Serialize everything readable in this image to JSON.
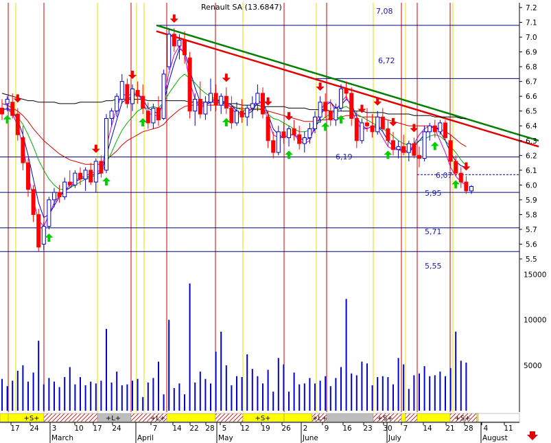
{
  "chart_data": {
    "type": "candlestick",
    "title": "Renault SA (13.6847)",
    "colors": {
      "background": "#ffffff",
      "up_candle": "#0000cc",
      "down_candle": "#ff0000",
      "sma_long": "#000000",
      "sma_mid": "#cc0000",
      "sma_short": "#00aa00",
      "sma_fast": "#0000cc",
      "sma_fastest": "#cc00cc",
      "volume": "#0000cc",
      "buy_arrow": "#00cc00",
      "sell_arrow": "#ee0000",
      "trend_green": "#008000",
      "trend_red": "#e00000",
      "level_line": "#000080",
      "cycle_red": "#cc0000",
      "cycle_yellow": "#e6e000",
      "band_yellow": "#ffff00",
      "band_hatch": "#cc0000",
      "band_gray": "#bdbdbd"
    },
    "ylim": [
      5.5,
      7.2
    ],
    "yticks": [
      "7.2",
      "7.1",
      "7.0",
      "6.9",
      "6.8",
      "6.7",
      "6.6",
      "6.5",
      "6.4",
      "6.3",
      "6.2",
      "6.1",
      "6.0",
      "5.9",
      "5.8",
      "5.7",
      "5.6",
      "5.5"
    ],
    "volume_ylim": [
      0,
      17000
    ],
    "volume_ticks": [
      "15000",
      "10000",
      "5000"
    ],
    "x_day_ticks": [
      "17",
      "24",
      "3",
      "10",
      "17",
      "24",
      "7",
      "14",
      "22",
      "28",
      "5",
      "12",
      "19",
      "26",
      "2",
      "9",
      "16",
      "23",
      "30",
      "7",
      "14",
      "21",
      "28",
      "4",
      "11"
    ],
    "x_month_labels": [
      "March",
      "April",
      "May",
      "June",
      "July",
      "August"
    ],
    "level_labels": [
      "7,08",
      "6,72",
      "6,19",
      "6,07",
      "5,95",
      "5,71",
      "5,55"
    ],
    "levels": [
      7.08,
      6.72,
      6.19,
      6.07,
      5.95,
      5.71,
      5.55
    ],
    "trendlines": [
      {
        "color": "green",
        "from": [
          0,
          7.08
        ],
        "to": [
          1,
          6.3
        ]
      },
      {
        "color": "red",
        "from": [
          0,
          7.04
        ],
        "to": [
          1,
          6.26
        ]
      }
    ],
    "band_labels": [
      "+S+",
      "+L+",
      "+L+",
      "+S+",
      "+L+",
      "+S+",
      "+S+"
    ],
    "band_segments": [
      "yellow",
      "yellow",
      "hatch",
      "gray",
      "hatch",
      "yellow",
      "hatch",
      "yellow",
      "yellow",
      "hatch",
      "gray",
      "hatch",
      "yellow",
      "hatch",
      "yellow",
      "hatch",
      "yellow",
      "hatch"
    ],
    "candles": [
      {
        "o": 6.52,
        "h": 6.58,
        "l": 6.44,
        "c": 6.48
      },
      {
        "o": 6.55,
        "h": 6.6,
        "l": 6.5,
        "c": 6.58
      },
      {
        "o": 6.56,
        "h": 6.62,
        "l": 6.45,
        "c": 6.47
      },
      {
        "o": 6.48,
        "h": 6.52,
        "l": 6.3,
        "c": 6.34
      },
      {
        "o": 6.32,
        "h": 6.4,
        "l": 6.1,
        "c": 6.15
      },
      {
        "o": 6.15,
        "h": 6.18,
        "l": 5.92,
        "c": 5.97
      },
      {
        "o": 5.97,
        "h": 6.0,
        "l": 5.75,
        "c": 5.8
      },
      {
        "o": 5.8,
        "h": 5.84,
        "l": 5.55,
        "c": 5.58
      },
      {
        "o": 5.6,
        "h": 5.75,
        "l": 5.56,
        "c": 5.72
      },
      {
        "o": 5.72,
        "h": 5.92,
        "l": 5.7,
        "c": 5.9
      },
      {
        "o": 5.9,
        "h": 5.98,
        "l": 5.85,
        "c": 5.95
      },
      {
        "o": 5.95,
        "h": 6.0,
        "l": 5.88,
        "c": 5.92
      },
      {
        "o": 5.92,
        "h": 6.05,
        "l": 5.9,
        "c": 6.02
      },
      {
        "o": 6.02,
        "h": 6.1,
        "l": 5.98,
        "c": 6.0
      },
      {
        "o": 6.0,
        "h": 6.1,
        "l": 5.98,
        "c": 6.08
      },
      {
        "o": 6.08,
        "h": 6.12,
        "l": 6.0,
        "c": 6.04
      },
      {
        "o": 6.04,
        "h": 6.12,
        "l": 5.96,
        "c": 6.1
      },
      {
        "o": 6.1,
        "h": 6.15,
        "l": 6.0,
        "c": 6.02
      },
      {
        "o": 6.02,
        "h": 6.18,
        "l": 5.95,
        "c": 6.16
      },
      {
        "o": 6.16,
        "h": 6.2,
        "l": 6.05,
        "c": 6.08
      },
      {
        "o": 6.1,
        "h": 6.48,
        "l": 6.08,
        "c": 6.45
      },
      {
        "o": 6.45,
        "h": 6.52,
        "l": 6.4,
        "c": 6.5
      },
      {
        "o": 6.5,
        "h": 6.62,
        "l": 6.46,
        "c": 6.6
      },
      {
        "o": 6.58,
        "h": 6.75,
        "l": 6.55,
        "c": 6.7
      },
      {
        "o": 6.68,
        "h": 6.72,
        "l": 6.52,
        "c": 6.55
      },
      {
        "o": 6.55,
        "h": 6.68,
        "l": 6.5,
        "c": 6.65
      },
      {
        "o": 6.64,
        "h": 6.7,
        "l": 6.55,
        "c": 6.6
      },
      {
        "o": 6.6,
        "h": 6.68,
        "l": 6.48,
        "c": 6.52
      },
      {
        "o": 6.5,
        "h": 6.56,
        "l": 6.38,
        "c": 6.42
      },
      {
        "o": 6.42,
        "h": 6.55,
        "l": 6.38,
        "c": 6.52
      },
      {
        "o": 6.52,
        "h": 6.6,
        "l": 6.4,
        "c": 6.44
      },
      {
        "o": 6.45,
        "h": 6.78,
        "l": 6.44,
        "c": 6.75
      },
      {
        "o": 6.8,
        "h": 7.05,
        "l": 6.78,
        "c": 7.02
      },
      {
        "o": 7.02,
        "h": 7.06,
        "l": 6.9,
        "c": 6.94
      },
      {
        "o": 6.94,
        "h": 7.02,
        "l": 6.85,
        "c": 6.98
      },
      {
        "o": 6.98,
        "h": 7.04,
        "l": 6.82,
        "c": 6.88
      },
      {
        "o": 6.86,
        "h": 6.9,
        "l": 6.45,
        "c": 6.5
      },
      {
        "o": 6.5,
        "h": 6.62,
        "l": 6.4,
        "c": 6.58
      },
      {
        "o": 6.58,
        "h": 6.7,
        "l": 6.45,
        "c": 6.48
      },
      {
        "o": 6.48,
        "h": 6.6,
        "l": 6.44,
        "c": 6.56
      },
      {
        "o": 6.56,
        "h": 6.72,
        "l": 6.5,
        "c": 6.62
      },
      {
        "o": 6.62,
        "h": 6.68,
        "l": 6.5,
        "c": 6.54
      },
      {
        "o": 6.54,
        "h": 6.62,
        "l": 6.48,
        "c": 6.6
      },
      {
        "o": 6.6,
        "h": 6.66,
        "l": 6.48,
        "c": 6.52
      },
      {
        "o": 6.52,
        "h": 6.6,
        "l": 6.38,
        "c": 6.42
      },
      {
        "o": 6.42,
        "h": 6.56,
        "l": 6.4,
        "c": 6.5
      },
      {
        "o": 6.5,
        "h": 6.58,
        "l": 6.42,
        "c": 6.46
      },
      {
        "o": 6.46,
        "h": 6.54,
        "l": 6.4,
        "c": 6.52
      },
      {
        "o": 6.52,
        "h": 6.6,
        "l": 6.45,
        "c": 6.55
      },
      {
        "o": 6.55,
        "h": 6.68,
        "l": 6.5,
        "c": 6.62
      },
      {
        "o": 6.62,
        "h": 6.66,
        "l": 6.45,
        "c": 6.48
      },
      {
        "o": 6.46,
        "h": 6.5,
        "l": 6.25,
        "c": 6.3
      },
      {
        "o": 6.3,
        "h": 6.36,
        "l": 6.18,
        "c": 6.22
      },
      {
        "o": 6.22,
        "h": 6.4,
        "l": 6.2,
        "c": 6.36
      },
      {
        "o": 6.36,
        "h": 6.42,
        "l": 6.28,
        "c": 6.32
      },
      {
        "o": 6.32,
        "h": 6.4,
        "l": 6.26,
        "c": 6.38
      },
      {
        "o": 6.38,
        "h": 6.44,
        "l": 6.3,
        "c": 6.34
      },
      {
        "o": 6.34,
        "h": 6.4,
        "l": 6.24,
        "c": 6.28
      },
      {
        "o": 6.28,
        "h": 6.36,
        "l": 6.22,
        "c": 6.32
      },
      {
        "o": 6.32,
        "h": 6.42,
        "l": 6.28,
        "c": 6.38
      },
      {
        "o": 6.38,
        "h": 6.5,
        "l": 6.35,
        "c": 6.46
      },
      {
        "o": 6.46,
        "h": 6.6,
        "l": 6.42,
        "c": 6.56
      },
      {
        "o": 6.56,
        "h": 6.62,
        "l": 6.45,
        "c": 6.5
      },
      {
        "o": 6.5,
        "h": 6.58,
        "l": 6.4,
        "c": 6.44
      },
      {
        "o": 6.44,
        "h": 6.55,
        "l": 6.4,
        "c": 6.52
      },
      {
        "o": 6.52,
        "h": 6.68,
        "l": 6.5,
        "c": 6.65
      },
      {
        "o": 6.65,
        "h": 6.7,
        "l": 6.58,
        "c": 6.62
      },
      {
        "o": 6.62,
        "h": 6.66,
        "l": 6.4,
        "c": 6.45
      },
      {
        "o": 6.45,
        "h": 6.5,
        "l": 6.25,
        "c": 6.3
      },
      {
        "o": 6.3,
        "h": 6.45,
        "l": 6.28,
        "c": 6.42
      },
      {
        "o": 6.42,
        "h": 6.52,
        "l": 6.36,
        "c": 6.4
      },
      {
        "o": 6.4,
        "h": 6.48,
        "l": 6.32,
        "c": 6.36
      },
      {
        "o": 6.36,
        "h": 6.5,
        "l": 6.34,
        "c": 6.46
      },
      {
        "o": 6.46,
        "h": 6.52,
        "l": 6.36,
        "c": 6.38
      },
      {
        "o": 6.38,
        "h": 6.44,
        "l": 6.26,
        "c": 6.3
      },
      {
        "o": 6.3,
        "h": 6.36,
        "l": 6.2,
        "c": 6.24
      },
      {
        "o": 6.24,
        "h": 6.3,
        "l": 6.18,
        "c": 6.26
      },
      {
        "o": 6.26,
        "h": 6.34,
        "l": 6.2,
        "c": 6.22
      },
      {
        "o": 6.22,
        "h": 6.3,
        "l": 6.16,
        "c": 6.28
      },
      {
        "o": 6.28,
        "h": 6.32,
        "l": 6.18,
        "c": 6.2
      },
      {
        "o": 6.2,
        "h": 6.26,
        "l": 6.12,
        "c": 6.18
      },
      {
        "o": 6.18,
        "h": 6.4,
        "l": 6.16,
        "c": 6.36
      },
      {
        "o": 6.36,
        "h": 6.42,
        "l": 6.3,
        "c": 6.4
      },
      {
        "o": 6.4,
        "h": 6.44,
        "l": 6.32,
        "c": 6.36
      },
      {
        "o": 6.36,
        "h": 6.44,
        "l": 6.34,
        "c": 6.42
      },
      {
        "o": 6.42,
        "h": 6.44,
        "l": 6.3,
        "c": 6.32
      },
      {
        "o": 6.3,
        "h": 6.34,
        "l": 6.12,
        "c": 6.16
      },
      {
        "o": 6.16,
        "h": 6.2,
        "l": 6.06,
        "c": 6.08
      },
      {
        "o": 6.08,
        "h": 6.12,
        "l": 5.98,
        "c": 6.02
      },
      {
        "o": 6.02,
        "h": 6.06,
        "l": 5.94,
        "c": 5.96
      },
      {
        "o": 5.96,
        "h": 6.0,
        "l": 5.94,
        "c": 5.99
      }
    ],
    "sma_long": [
      6.62,
      6.61,
      6.6,
      6.59,
      6.58,
      6.57,
      6.57,
      6.56,
      6.56,
      6.56,
      6.56,
      6.55,
      6.55,
      6.55,
      6.55,
      6.56,
      6.56,
      6.56,
      6.56,
      6.56,
      6.57,
      6.57,
      6.58,
      6.58,
      6.58,
      6.58,
      6.58,
      6.58,
      6.57,
      6.57,
      6.57,
      6.57,
      6.57,
      6.57,
      6.57,
      6.57,
      6.56,
      6.56,
      6.56,
      6.56,
      6.56,
      6.56,
      6.55,
      6.55,
      6.55,
      6.55,
      6.54,
      6.54,
      6.54,
      6.54,
      6.53,
      6.53,
      6.53,
      6.53,
      6.53,
      6.52,
      6.52,
      6.52,
      6.52,
      6.51,
      6.51,
      6.51,
      6.51,
      6.5,
      6.5,
      6.5,
      6.5,
      6.5,
      6.5,
      6.5,
      6.49,
      6.49,
      6.49,
      6.49,
      6.48,
      6.48,
      6.48,
      6.48,
      6.48,
      6.47,
      6.47,
      6.47,
      6.47,
      6.46,
      6.46,
      6.46,
      6.46,
      6.46,
      6.45,
      6.45
    ],
    "sma_mid": [
      6.55,
      6.54,
      6.52,
      6.5,
      6.47,
      6.43,
      6.38,
      6.34,
      6.3,
      6.27,
      6.24,
      6.21,
      6.19,
      6.17,
      6.16,
      6.15,
      6.14,
      6.14,
      6.14,
      6.14,
      6.17,
      6.2,
      6.23,
      6.27,
      6.3,
      6.32,
      6.34,
      6.36,
      6.37,
      6.38,
      6.39,
      6.41,
      6.45,
      6.48,
      6.51,
      6.53,
      6.54,
      6.54,
      6.54,
      6.54,
      6.54,
      6.54,
      6.54,
      6.54,
      6.53,
      6.52,
      6.52,
      6.51,
      6.51,
      6.51,
      6.51,
      6.5,
      6.49,
      6.48,
      6.47,
      6.46,
      6.45,
      6.44,
      6.43,
      6.43,
      6.43,
      6.44,
      6.44,
      6.45,
      6.45,
      6.46,
      6.47,
      6.47,
      6.47,
      6.46,
      6.46,
      6.46,
      6.46,
      6.45,
      6.44,
      6.43,
      6.42,
      6.41,
      6.4,
      6.4,
      6.4,
      6.4,
      6.4,
      6.39,
      6.38,
      6.36,
      6.34,
      6.31,
      6.28,
      6.26
    ],
    "sma_short": [
      6.52,
      6.51,
      6.49,
      6.46,
      6.41,
      6.34,
      6.26,
      6.17,
      6.1,
      6.04,
      6.0,
      5.97,
      5.97,
      5.98,
      6.0,
      6.02,
      6.04,
      6.05,
      6.07,
      6.08,
      6.15,
      6.22,
      6.3,
      6.37,
      6.42,
      6.46,
      6.5,
      6.52,
      6.52,
      6.53,
      6.52,
      6.56,
      6.62,
      6.67,
      6.72,
      6.75,
      6.72,
      6.69,
      6.65,
      6.62,
      6.6,
      6.58,
      6.57,
      6.56,
      6.54,
      6.52,
      6.51,
      6.5,
      6.51,
      6.52,
      6.51,
      6.48,
      6.45,
      6.44,
      6.42,
      6.4,
      6.38,
      6.36,
      6.36,
      6.37,
      6.4,
      6.43,
      6.46,
      6.48,
      6.5,
      6.52,
      6.53,
      6.51,
      6.48,
      6.46,
      6.44,
      6.42,
      6.4,
      6.38,
      6.36,
      6.33,
      6.3,
      6.28,
      6.27,
      6.28,
      6.3,
      6.31,
      6.33,
      6.34,
      6.33,
      6.3,
      6.26,
      6.22,
      6.17,
      6.13
    ],
    "sma_fast": [
      6.5,
      6.52,
      6.5,
      6.44,
      6.34,
      6.2,
      6.04,
      5.88,
      5.78,
      5.8,
      5.86,
      5.92,
      5.96,
      5.98,
      6.02,
      6.04,
      6.05,
      6.06,
      6.08,
      6.08,
      6.2,
      6.32,
      6.44,
      6.56,
      6.58,
      6.6,
      6.62,
      6.58,
      6.52,
      6.5,
      6.48,
      6.56,
      6.7,
      6.82,
      6.92,
      6.9,
      6.78,
      6.66,
      6.56,
      6.54,
      6.56,
      6.58,
      6.56,
      6.56,
      6.54,
      6.5,
      6.48,
      6.48,
      6.5,
      6.56,
      6.56,
      6.48,
      6.38,
      6.34,
      6.32,
      6.34,
      6.34,
      6.32,
      6.3,
      6.32,
      6.38,
      6.46,
      6.54,
      6.56,
      6.52,
      6.54,
      6.58,
      6.55,
      6.46,
      6.4,
      6.38,
      6.4,
      6.4,
      6.36,
      6.3,
      6.26,
      6.24,
      6.24,
      6.22,
      6.26,
      6.3,
      6.34,
      6.38,
      6.4,
      6.36,
      6.3,
      6.22,
      6.16,
      6.13,
      6.12
    ],
    "sma_fastest": [
      6.5,
      6.52,
      6.48,
      6.4,
      6.26,
      6.08,
      5.9,
      5.76,
      5.72,
      5.8,
      5.88,
      5.93,
      5.96,
      6.0,
      6.03,
      6.05,
      6.06,
      6.08,
      6.09,
      6.1,
      6.26,
      6.4,
      6.52,
      6.62,
      6.6,
      6.62,
      6.62,
      6.56,
      6.48,
      6.48,
      6.46,
      6.58,
      6.76,
      6.88,
      6.94,
      6.88,
      6.7,
      6.58,
      6.52,
      6.54,
      6.58,
      6.58,
      6.55,
      6.56,
      6.52,
      6.48,
      6.48,
      6.49,
      6.52,
      6.58,
      6.54,
      6.44,
      6.34,
      6.32,
      6.32,
      6.34,
      6.34,
      6.3,
      6.28,
      6.3,
      6.4,
      6.5,
      6.56,
      6.56,
      6.5,
      6.56,
      6.6,
      6.52,
      6.42,
      6.38,
      6.38,
      6.4,
      6.38,
      6.32,
      6.26,
      6.24,
      6.24,
      6.22,
      6.22,
      6.28,
      6.34,
      6.38,
      6.4,
      6.38,
      6.3,
      6.22,
      6.12,
      6.06,
      6.02,
      6.0
    ],
    "volumes": [
      3500,
      2700,
      3300,
      4400,
      5000,
      3200,
      4200,
      7700,
      2900,
      3600,
      3200,
      2600,
      3700,
      4800,
      2900,
      3700,
      2800,
      3200,
      3000,
      3300,
      9000,
      3100,
      4300,
      2800,
      2900,
      3300,
      3500,
      1500,
      3100,
      3600,
      5400,
      1800,
      10000,
      2500,
      3000,
      1800,
      14000,
      3100,
      4300,
      3500,
      3000,
      6500,
      8700,
      5000,
      2800,
      3800,
      3700,
      6200,
      4600,
      3800,
      3000,
      4500,
      2100,
      5800,
      5100,
      2100,
      4200,
      2900,
      3000,
      3600,
      3000,
      3300,
      3800,
      2700,
      3600,
      4800,
      12300,
      4100,
      3900,
      5400,
      5200,
      2800,
      3700,
      3800,
      3700,
      2900,
      5800,
      5100,
      2400,
      3900,
      4100,
      4900,
      3800,
      3900,
      4300,
      3800,
      4700,
      8700,
      5500,
      5300
    ],
    "buy_signals": [
      1,
      9,
      20,
      27,
      43,
      55,
      62,
      65,
      74,
      83,
      87
    ],
    "sell_signals": [
      3,
      18,
      25,
      33,
      43,
      51,
      55,
      61,
      69,
      72,
      75,
      79,
      89
    ]
  }
}
